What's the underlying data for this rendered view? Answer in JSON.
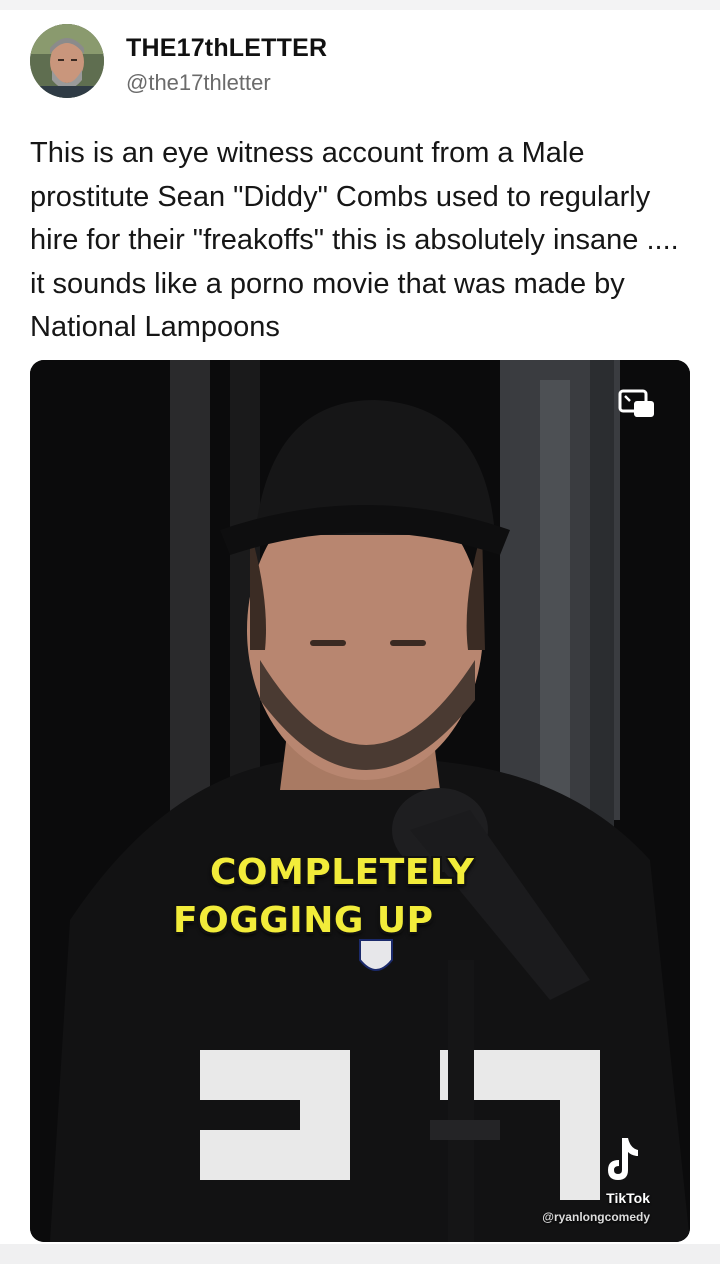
{
  "post": {
    "author": {
      "display_name": "THE17thLETTER",
      "handle": "@the17thletter",
      "avatar_icon": "profile-photo"
    },
    "text": "This is an eye witness account from a Male prostitute Sean \"Diddy\" Combs used to regularly hire for their \"freakoffs\" this is absolutely insane .... it sounds like a porno movie that was made by National Lampoons"
  },
  "video": {
    "caption_line1": "COMPLETELY",
    "caption_line2": "FOGGING UP",
    "jersey_logo": "NFL",
    "pip_icon": "picture-in-picture-icon",
    "watermark": {
      "brand": "TikTok",
      "user": "@ryanlongcomedy"
    }
  },
  "colors": {
    "caption": "#f2ec3a",
    "text": "#161616",
    "handle": "#6b6b6b"
  }
}
